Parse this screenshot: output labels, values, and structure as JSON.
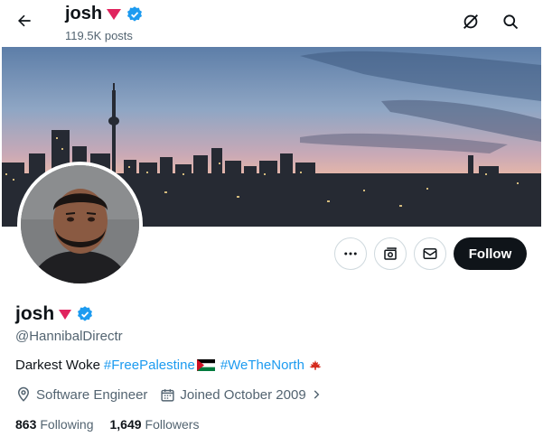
{
  "header": {
    "name": "josh",
    "posts": "119.5K posts"
  },
  "profile": {
    "name": "josh",
    "handle": "@HannibalDirectr",
    "bio": {
      "text": "Darkest Woke",
      "hashtag1": "#FreePalestine",
      "hashtag2": "#WeTheNorth"
    },
    "location": "Software Engineer",
    "joined": "Joined October 2009",
    "following_count": "863",
    "following_label": "Following",
    "followers_count": "1,649",
    "followers_label": "Followers"
  },
  "actions": {
    "follow_label": "Follow"
  },
  "icons": {
    "back": "arrow-left-icon",
    "grok": "grok-icon",
    "search": "search-icon",
    "more": "more-icon",
    "subscribe": "subscribe-icon",
    "message": "message-icon",
    "verified": "verified-badge-icon",
    "location": "location-icon",
    "calendar": "calendar-icon"
  },
  "colors": {
    "accent": "#1d9bf0",
    "text": "#0f1419",
    "muted": "#536471",
    "triangle": "#e0245e",
    "follow_bg": "#0f1419"
  }
}
